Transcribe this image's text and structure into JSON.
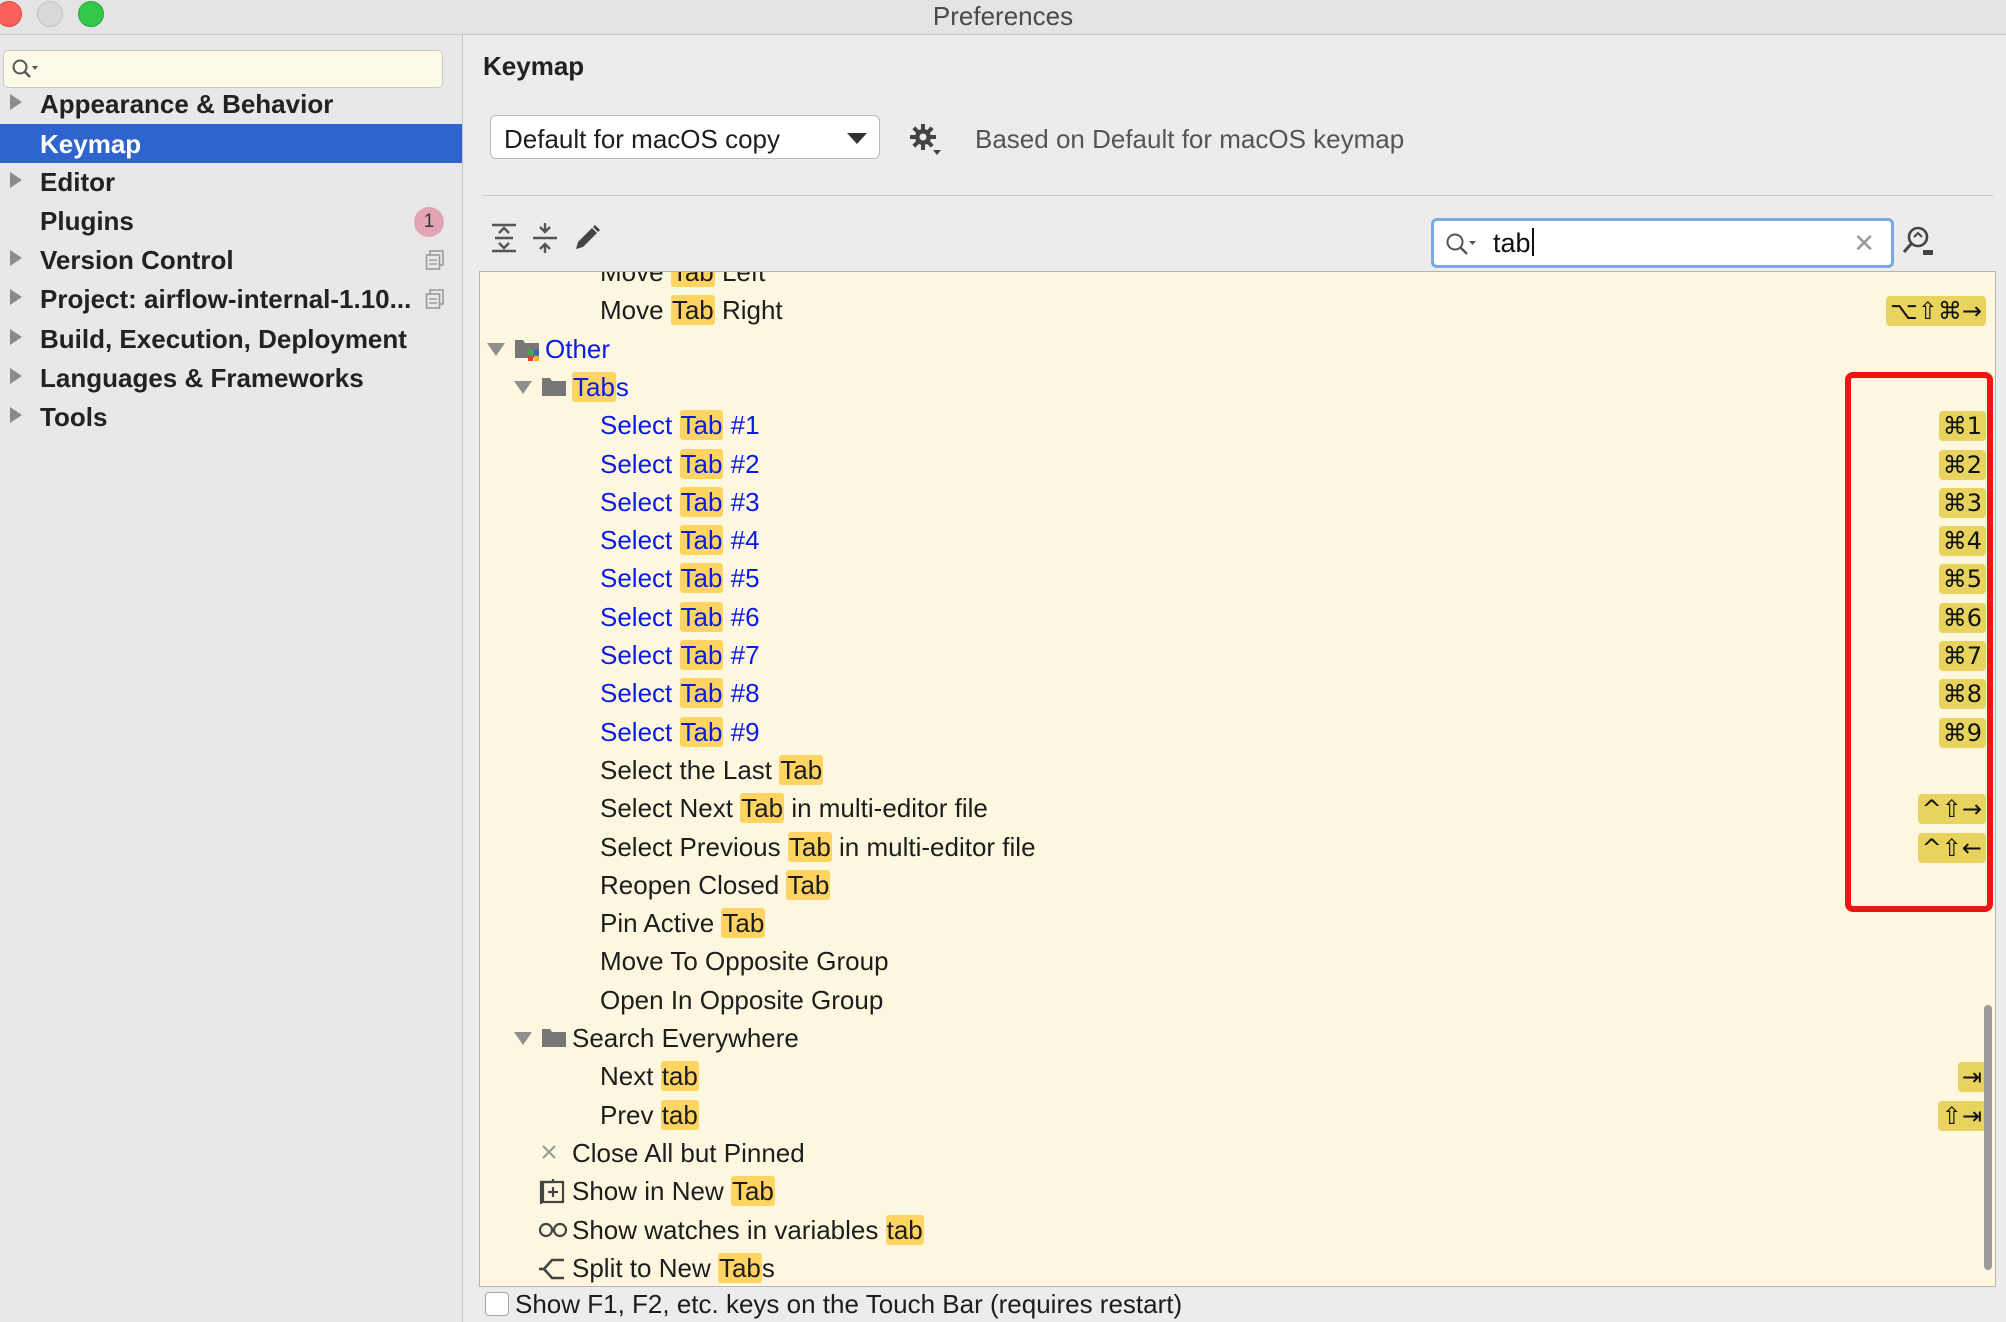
{
  "window": {
    "title": "Preferences"
  },
  "sidebar": {
    "search_placeholder": "",
    "items": [
      {
        "label": "Appearance & Behavior",
        "expandable": true
      },
      {
        "label": "Keymap",
        "selected": true
      },
      {
        "label": "Editor",
        "expandable": true
      },
      {
        "label": "Plugins",
        "badge": "1"
      },
      {
        "label": "Version Control",
        "expandable": true
      },
      {
        "label": "Project: airflow-internal-1.10...",
        "expandable": true
      },
      {
        "label": "Build, Execution, Deployment",
        "expandable": true
      },
      {
        "label": "Languages & Frameworks",
        "expandable": true
      },
      {
        "label": "Tools",
        "expandable": true
      }
    ]
  },
  "main": {
    "heading": "Keymap",
    "keymap_select": "Default for macOS copy",
    "based_on": "Based on Default for macOS keymap",
    "search_value": "tab",
    "tree": [
      {
        "text": [
          "Move ",
          "Tab",
          " Left"
        ],
        "color": "black",
        "shortcut": "⌥⇧⌘←",
        "clipped": true
      },
      {
        "text": [
          "Move ",
          "Tab",
          " Right"
        ],
        "color": "black",
        "shortcut": "⌥⇧⌘→"
      },
      {
        "text": [
          "Other"
        ],
        "color": "blue",
        "group": true
      },
      {
        "text": [
          "",
          "Tab",
          "s"
        ],
        "color": "blue",
        "group": true
      },
      {
        "text": [
          "Select ",
          "Tab",
          " #1"
        ],
        "color": "blue",
        "shortcut": "⌘1"
      },
      {
        "text": [
          "Select ",
          "Tab",
          " #2"
        ],
        "color": "blue",
        "shortcut": "⌘2"
      },
      {
        "text": [
          "Select ",
          "Tab",
          " #3"
        ],
        "color": "blue",
        "shortcut": "⌘3"
      },
      {
        "text": [
          "Select ",
          "Tab",
          " #4"
        ],
        "color": "blue",
        "shortcut": "⌘4"
      },
      {
        "text": [
          "Select ",
          "Tab",
          " #5"
        ],
        "color": "blue",
        "shortcut": "⌘5"
      },
      {
        "text": [
          "Select ",
          "Tab",
          " #6"
        ],
        "color": "blue",
        "shortcut": "⌘6"
      },
      {
        "text": [
          "Select ",
          "Tab",
          " #7"
        ],
        "color": "blue",
        "shortcut": "⌘7"
      },
      {
        "text": [
          "Select ",
          "Tab",
          " #8"
        ],
        "color": "blue",
        "shortcut": "⌘8"
      },
      {
        "text": [
          "Select ",
          "Tab",
          " #9"
        ],
        "color": "blue",
        "shortcut": "⌘9"
      },
      {
        "text": [
          "Select the Last ",
          "Tab",
          ""
        ],
        "color": "black"
      },
      {
        "text": [
          "Select Next ",
          "Tab",
          " in multi-editor file"
        ],
        "color": "black",
        "shortcut": "^⇧→"
      },
      {
        "text": [
          "Select Previous ",
          "Tab",
          " in multi-editor file"
        ],
        "color": "black",
        "shortcut": "^⇧←"
      },
      {
        "text": [
          "Reopen Closed ",
          "Tab",
          ""
        ],
        "color": "black"
      },
      {
        "text": [
          "Pin Active ",
          "Tab",
          ""
        ],
        "color": "black"
      },
      {
        "text": [
          "Move To Opposite Group"
        ],
        "color": "black"
      },
      {
        "text": [
          "Open In Opposite Group"
        ],
        "color": "black"
      },
      {
        "text": [
          "Search Everywhere"
        ],
        "color": "black",
        "group": true
      },
      {
        "text": [
          "Next ",
          "tab",
          ""
        ],
        "color": "black",
        "shortcut": "⇥"
      },
      {
        "text": [
          "Prev ",
          "tab",
          ""
        ],
        "color": "black",
        "shortcut": "⇧⇥"
      },
      {
        "text": [
          "Close All but Pinned"
        ],
        "color": "black",
        "icon": "close-icon"
      },
      {
        "text": [
          "Show in New ",
          "Tab",
          ""
        ],
        "color": "black",
        "icon": "new-tab-icon"
      },
      {
        "text": [
          "Show watches in variables ",
          "tab",
          ""
        ],
        "color": "black",
        "icon": "glasses-icon"
      },
      {
        "text": [
          "Split to New ",
          "Tab",
          "s"
        ],
        "color": "black",
        "icon": "split-icon"
      }
    ]
  },
  "footer": {
    "touchbar_label": "Show F1, F2, etc. keys on the Touch Bar (requires restart)",
    "touchbar_checked": false
  },
  "colors": {
    "selection": "#2f64cf",
    "match_highlight": "#ffd462",
    "shortcut_bg": "#e7d35d",
    "action_blue": "#0a1be6",
    "annotation_red": "#f01414"
  }
}
